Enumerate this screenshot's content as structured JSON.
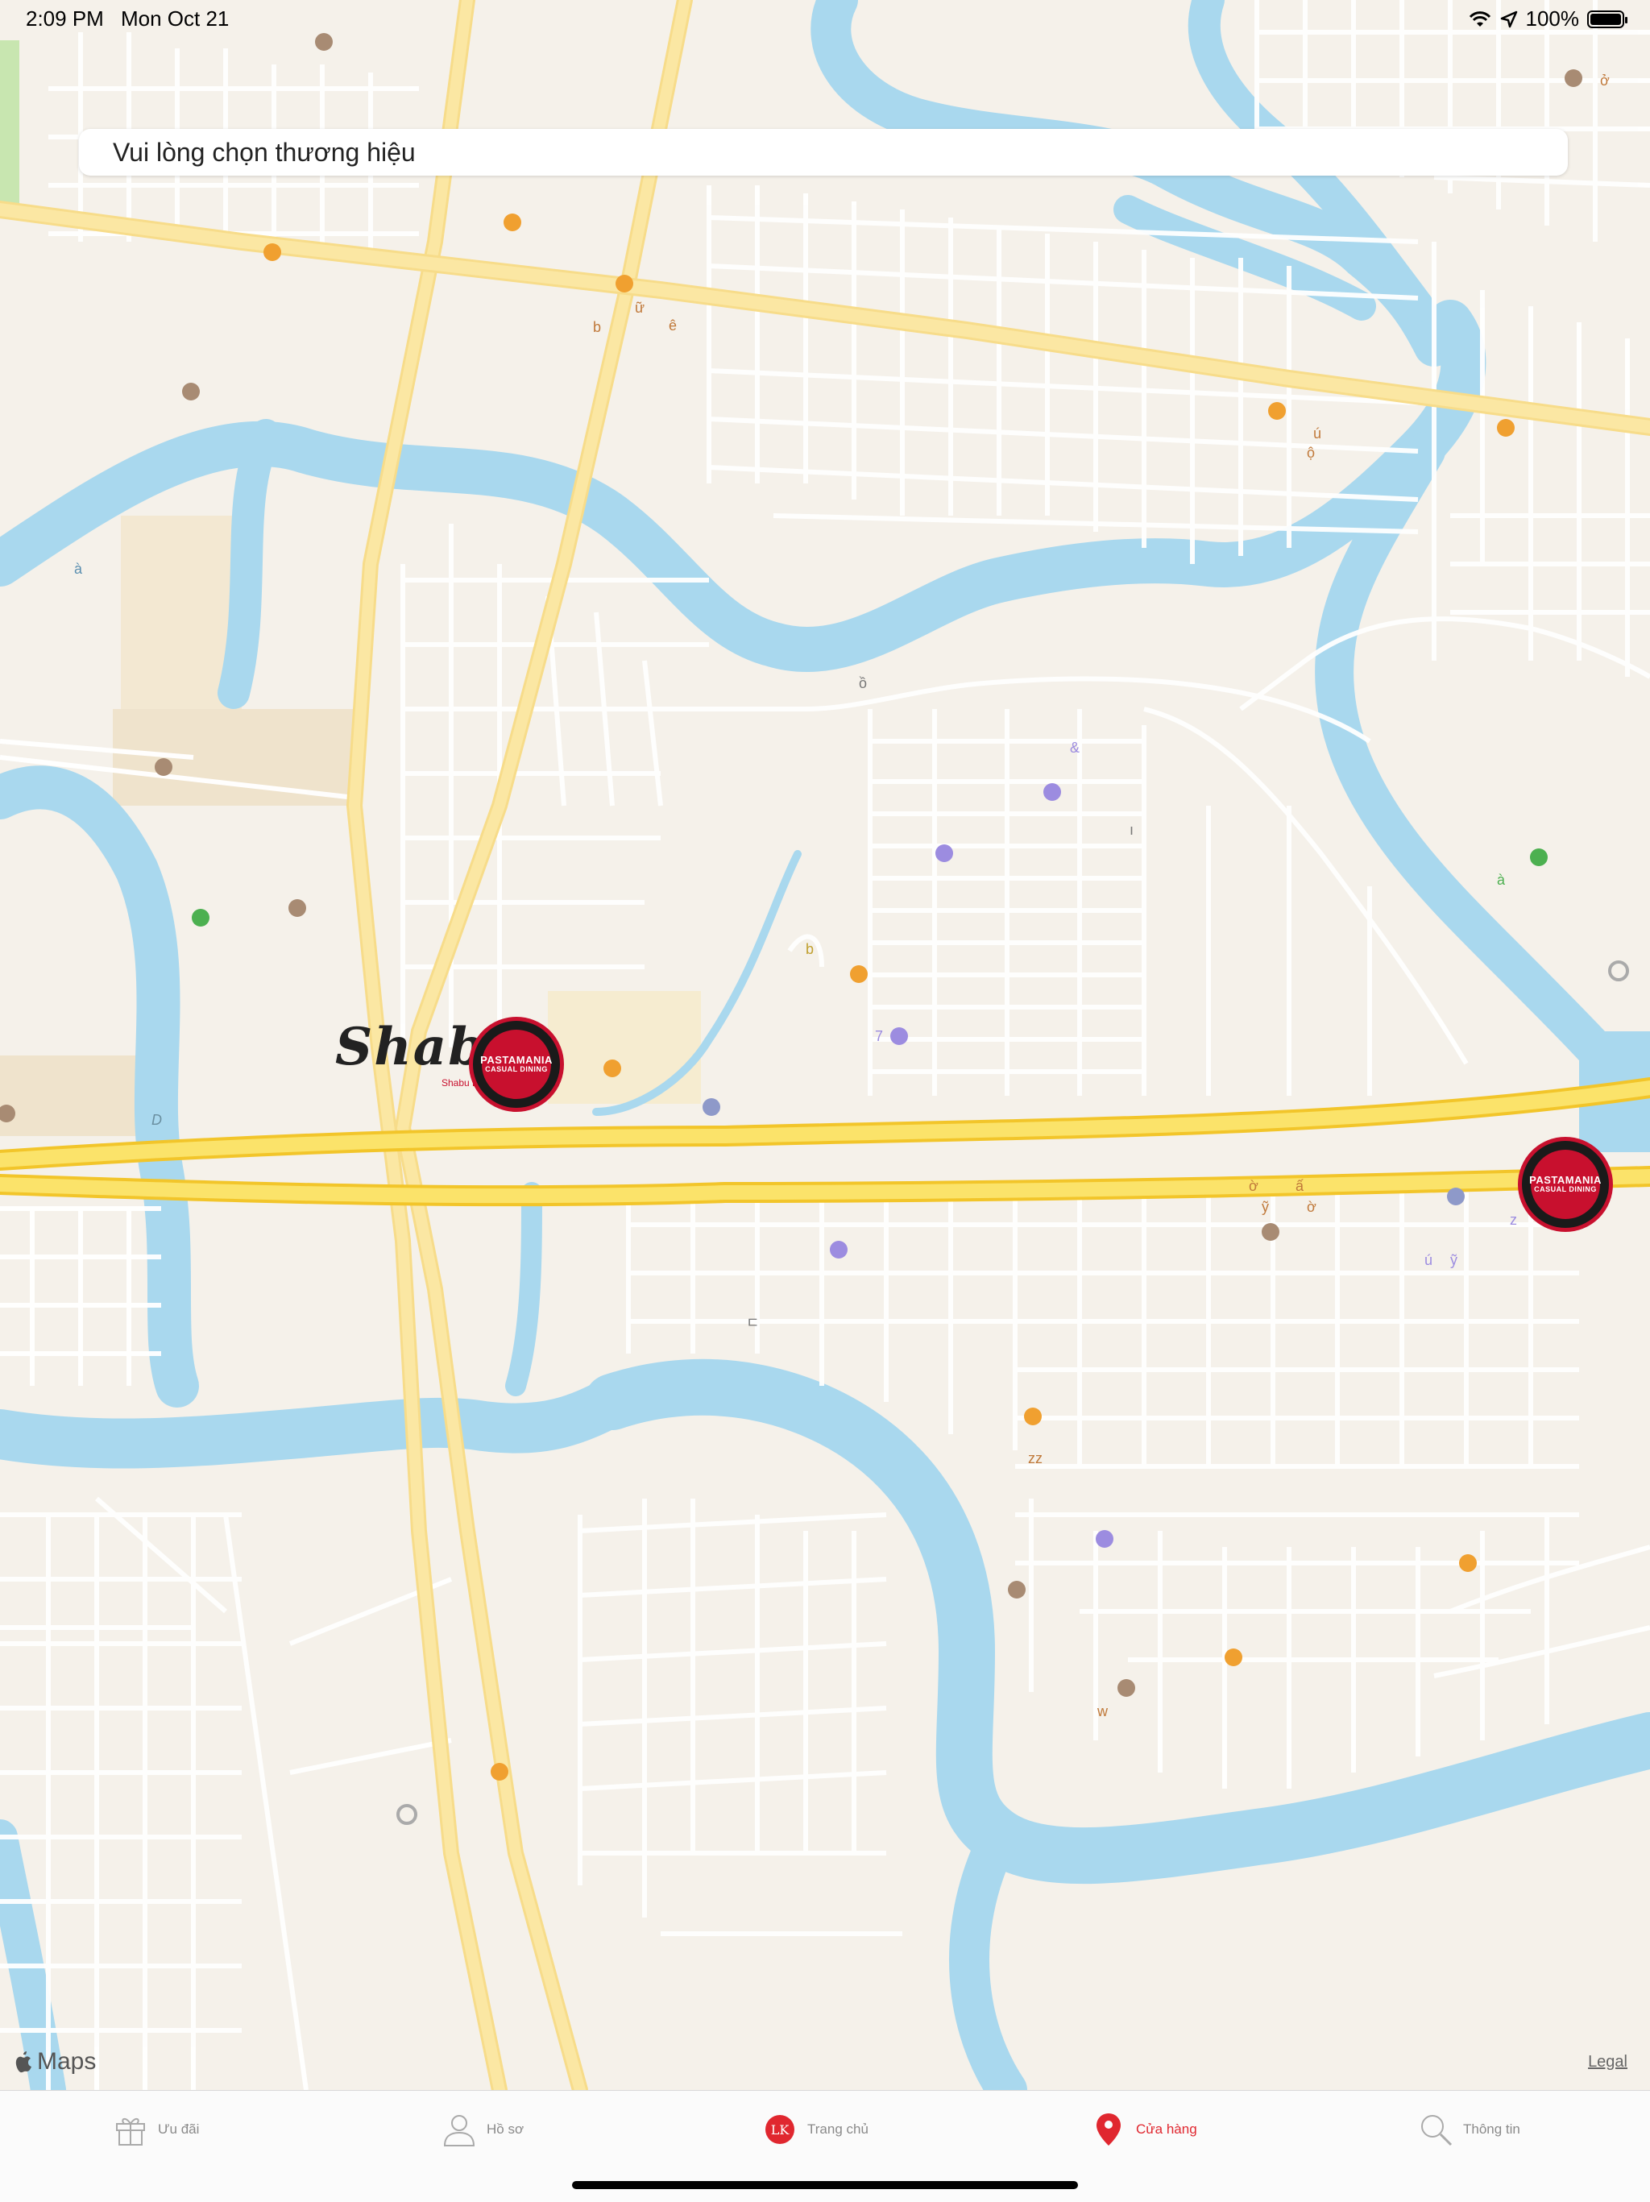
{
  "status_bar": {
    "time": "2:09 PM",
    "date": "Mon Oct 21",
    "battery": "100%",
    "wifi_icon": "wifi-icon",
    "location_icon": "location-arrow-icon",
    "battery_icon": "battery-icon"
  },
  "search": {
    "label": "Vui lòng chọn thương hiệu"
  },
  "map": {
    "attribution": "Maps",
    "legal": "Legal",
    "labels": [
      "ở",
      "b",
      "ữ",
      "ê",
      "ú",
      "ộ",
      "à",
      "ồ",
      "&",
      "ı",
      "b",
      "7",
      "à",
      "D",
      "ờ",
      "ấ",
      "ỹ",
      "ờ",
      "z",
      "ú",
      "ỹ",
      "ㄷ",
      "zz",
      "w"
    ],
    "markers": [
      {
        "brand": "Shabu",
        "sub": "Shabu Buffet"
      },
      {
        "brand": "PASTAMANIA",
        "sub": "CASUAL DINING"
      },
      {
        "brand": "PASTAMANIA",
        "sub": "CASUAL DINING"
      }
    ]
  },
  "tabs": [
    {
      "label": "Ưu đãi",
      "icon": "gift-icon"
    },
    {
      "label": "Hồ sơ",
      "icon": "user-icon"
    },
    {
      "label": "Trang chủ",
      "icon": "lk-logo-icon",
      "badge": "LK"
    },
    {
      "label": "Cửa hàng",
      "icon": "map-pin-icon"
    },
    {
      "label": "Thông tin",
      "icon": "search-icon"
    }
  ],
  "colors": {
    "land": "#f5f1ea",
    "water": "#a9d8ee",
    "road_major": "#f8d94a",
    "road_secondary": "#fbe7a3",
    "road_minor": "#ffffff",
    "accent": "#e0272f"
  }
}
